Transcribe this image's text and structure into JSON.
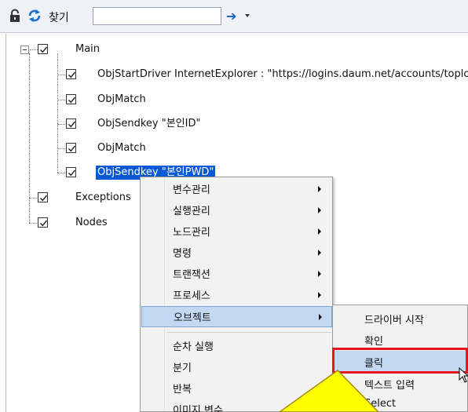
{
  "toolbar": {
    "find_label": "찾기",
    "search_value": "",
    "icons": [
      "lock-icon",
      "refresh-icon",
      "arrow-right-icon",
      "dropdown-icon"
    ]
  },
  "tree": {
    "root": "Main",
    "children": [
      "ObjStartDriver InternetExplorer : \"https://logins.daum.net/accounts/toplogin",
      "ObjMatch",
      "ObjSendkey \"본인ID\"",
      "ObjMatch",
      "ObjSendkey \"본인PWD\""
    ],
    "siblings": [
      "Exceptions",
      "Nodes"
    ]
  },
  "context_menu": {
    "items": [
      "변수관리",
      "실행관리",
      "노드관리",
      "명령",
      "트랜잭션",
      "프로세스",
      "오브젝트",
      "순차 실행",
      "분기",
      "반복",
      "이미지 변수"
    ]
  },
  "submenu": {
    "items": [
      "드라이버 시작",
      "확인",
      "클릭",
      "텍스트 입력",
      "Select"
    ]
  },
  "colors": {
    "selection": "#0a58d6",
    "menu_highlight": "#c3d9f3",
    "annotation_red": "#e8141e",
    "callout_yellow": "#ffff00"
  }
}
